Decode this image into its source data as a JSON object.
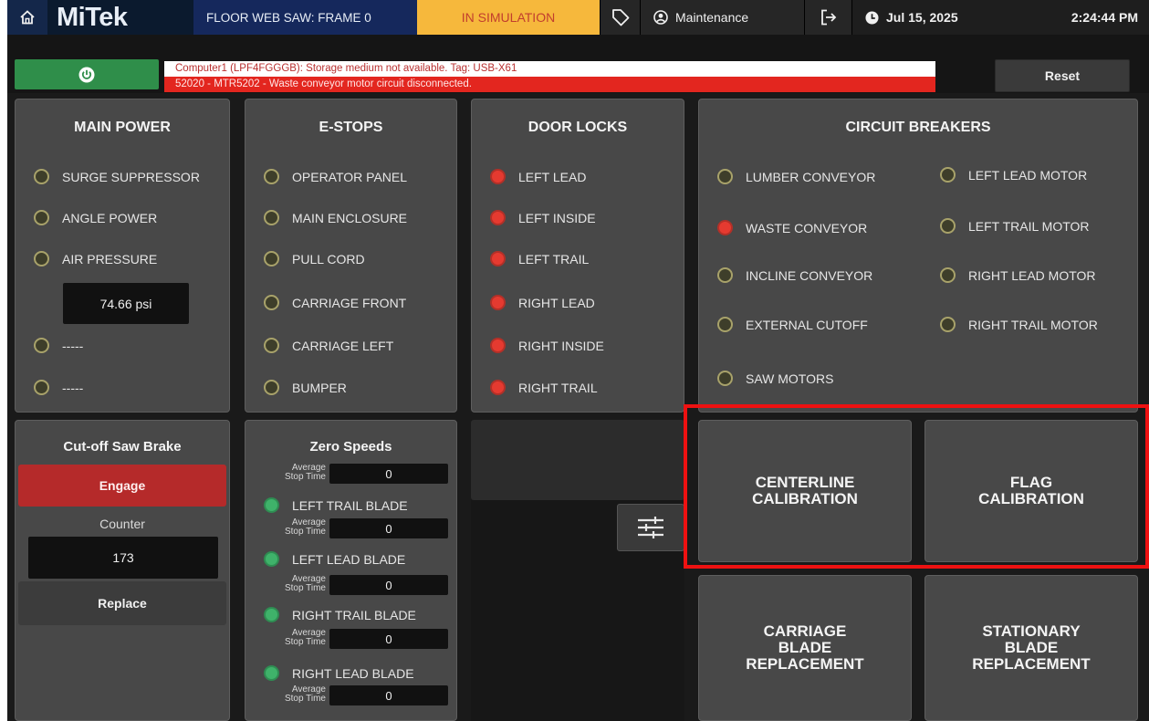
{
  "header": {
    "home_icon": "home-icon",
    "logo_text": "MiTek",
    "frame_title": "FLOOR WEB SAW: FRAME 0",
    "simulation_status": "IN SIMULATION",
    "tag_icon": "tag-icon",
    "user_mode": "Maintenance",
    "date": "Jul 15, 2025",
    "time": "2:24:44 PM"
  },
  "alarms": {
    "messages": [
      "Computer1 (LPF4FGGGB): Storage medium not available. Tag: USB-X61",
      "52020 - MTR5202 - Waste conveyor motor circuit disconnected."
    ],
    "reset_label": "Reset"
  },
  "main_power": {
    "title": "MAIN POWER",
    "items": [
      {
        "label": "SURGE SUPPRESSOR",
        "state": "off"
      },
      {
        "label": "ANGLE POWER",
        "state": "off"
      },
      {
        "label": "AIR PRESSURE",
        "state": "off"
      }
    ],
    "pressure_value": "74.66 psi",
    "extra_items": [
      {
        "label": "-----",
        "state": "off"
      },
      {
        "label": "-----",
        "state": "off"
      }
    ]
  },
  "estops": {
    "title": "E-STOPS",
    "items": [
      {
        "label": "OPERATOR PANEL",
        "state": "off"
      },
      {
        "label": "MAIN ENCLOSURE",
        "state": "off"
      },
      {
        "label": "PULL CORD",
        "state": "off"
      },
      {
        "label": "CARRIAGE FRONT",
        "state": "off"
      },
      {
        "label": "CARRIAGE LEFT",
        "state": "off"
      },
      {
        "label": "BUMPER",
        "state": "off"
      }
    ]
  },
  "door_locks": {
    "title": "DOOR LOCKS",
    "items": [
      {
        "label": "LEFT LEAD",
        "state": "fault"
      },
      {
        "label": "LEFT INSIDE",
        "state": "fault"
      },
      {
        "label": "LEFT TRAIL",
        "state": "fault"
      },
      {
        "label": "RIGHT LEAD",
        "state": "fault"
      },
      {
        "label": "RIGHT INSIDE",
        "state": "fault"
      },
      {
        "label": "RIGHT TRAIL",
        "state": "fault"
      }
    ]
  },
  "circuit_breakers": {
    "title": "CIRCUIT BREAKERS",
    "left_items": [
      {
        "label": "LUMBER CONVEYOR",
        "state": "off"
      },
      {
        "label": "WASTE CONVEYOR",
        "state": "fault"
      },
      {
        "label": "INCLINE CONVEYOR",
        "state": "off"
      },
      {
        "label": "EXTERNAL CUTOFF",
        "state": "off"
      },
      {
        "label": "SAW MOTORS",
        "state": "off"
      }
    ],
    "right_items": [
      {
        "label": "LEFT LEAD MOTOR",
        "state": "off"
      },
      {
        "label": "LEFT TRAIL MOTOR",
        "state": "off"
      },
      {
        "label": "RIGHT LEAD MOTOR",
        "state": "off"
      },
      {
        "label": "RIGHT TRAIL MOTOR",
        "state": "off"
      }
    ]
  },
  "saw_brake": {
    "title": "Cut-off Saw Brake",
    "engage_label": "Engage",
    "counter_label": "Counter",
    "counter_value": "173",
    "replace_label": "Replace"
  },
  "zero_speeds": {
    "title": "Zero Speeds",
    "avg_label": "Average Stop Time",
    "top_value": "0",
    "blades": [
      {
        "label": "LEFT TRAIL BLADE",
        "value": "0"
      },
      {
        "label": "LEFT LEAD BLADE",
        "value": "0"
      },
      {
        "label": "RIGHT TRAIL BLADE",
        "value": "0"
      },
      {
        "label": "RIGHT LEAD BLADE",
        "value": "0"
      }
    ]
  },
  "blank_panel": {
    "settings_icon": "sliders-icon"
  },
  "actions": {
    "centerline": "CENTERLINE\nCALIBRATION",
    "flag": "FLAG\nCALIBRATION",
    "carriage": "CARRIAGE\nBLADE\nREPLACEMENT",
    "stationary": "STATIONARY\nBLADE\nREPLACEMENT"
  },
  "colors": {
    "led_off": "#3e3e2a",
    "led_fault": "#e53a30",
    "led_ok": "#3fb26a",
    "simulation_bg": "#f6b83c",
    "highlight": "#ee1111"
  }
}
